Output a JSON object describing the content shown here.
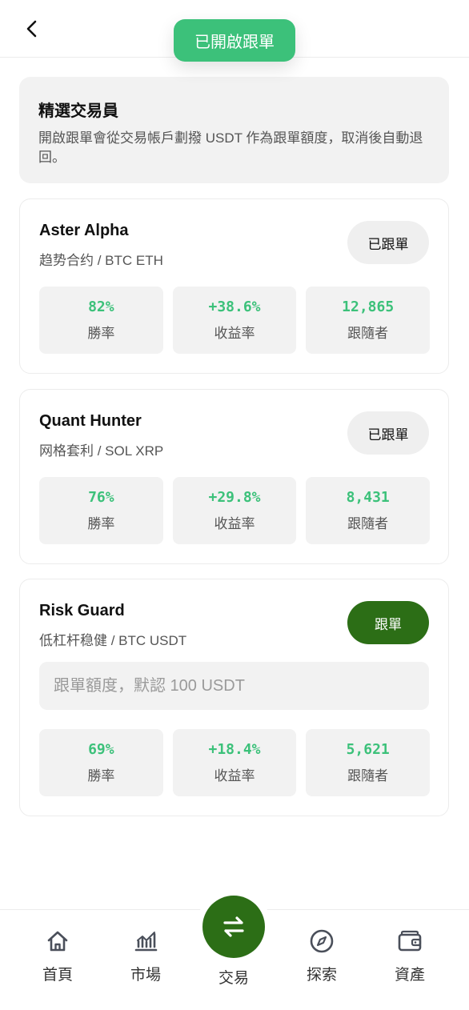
{
  "toast": {
    "text": "已開啟跟單"
  },
  "intro": {
    "title": "精選交易員",
    "description": "開啟跟單會從交易帳戶劃撥 USDT 作為跟單額度，取消後自動退回。"
  },
  "traders": [
    {
      "name": "Aster Alpha",
      "subtitle": "趋势合约 / BTC ETH",
      "button": "已跟單",
      "stats": [
        {
          "value": "82%",
          "label": "勝率"
        },
        {
          "value": "+38.6%",
          "label": "收益率"
        },
        {
          "value": "12,865",
          "label": "跟隨者"
        }
      ]
    },
    {
      "name": "Quant Hunter",
      "subtitle": "网格套利 / SOL XRP",
      "button": "已跟單",
      "stats": [
        {
          "value": "76%",
          "label": "勝率"
        },
        {
          "value": "+29.8%",
          "label": "收益率"
        },
        {
          "value": "8,431",
          "label": "跟隨者"
        }
      ]
    },
    {
      "name": "Risk Guard",
      "subtitle": "低杠杆稳健 / BTC USDT",
      "button": "跟單",
      "input_placeholder": "跟單額度，默認 100 USDT",
      "input_value": "",
      "stats": [
        {
          "value": "69%",
          "label": "勝率"
        },
        {
          "value": "+18.4%",
          "label": "收益率"
        },
        {
          "value": "5,621",
          "label": "跟隨者"
        }
      ]
    }
  ],
  "nav": {
    "home": "首頁",
    "market": "市場",
    "trade": "交易",
    "explore": "探索",
    "assets": "資產"
  },
  "colors": {
    "accent_green": "#3cc17a",
    "primary_dark_green": "#2c6e16",
    "card_bg": "#f2f2f2"
  },
  "icons": {
    "back": "chevron-left-icon",
    "home": "home-icon",
    "market": "chart-icon",
    "trade": "swap-arrows-icon",
    "explore": "compass-icon",
    "assets": "wallet-icon"
  }
}
